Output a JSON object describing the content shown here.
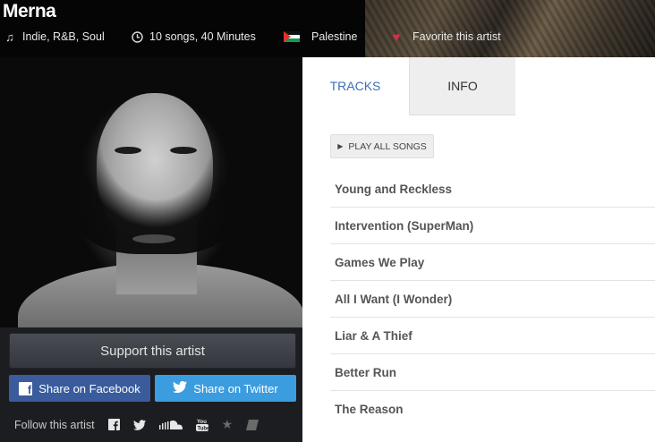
{
  "artist": {
    "name": "Merna",
    "genres": "Indie, R&B, Soul",
    "duration": "10 songs, 40 Minutes",
    "country": "Palestine",
    "favorite_label": "Favorite this artist"
  },
  "icons": {
    "genre": "music-note-icon",
    "duration": "clock-icon",
    "country": "palestine-flag-icon",
    "favorite": "heart-icon"
  },
  "colors": {
    "favorite_heart": "#d6304a",
    "facebook": "#3a5b9c",
    "twitter": "#3b9ce0",
    "tab_active": "#3a6fb5"
  },
  "actions": {
    "support": "Support this artist",
    "share_facebook": "Share on Facebook",
    "share_twitter": "Share on Twitter",
    "follow": "Follow this artist"
  },
  "tabs": [
    {
      "label": "TRACKS",
      "active": true
    },
    {
      "label": "INFO",
      "active": false
    }
  ],
  "play_all": "PLAY ALL SONGS",
  "tracks": [
    "Young and Reckless",
    "Intervention (SuperMan)",
    "Games We Play",
    "All I Want (I Wonder)",
    "Liar & A Thief",
    "Better Run",
    "The Reason"
  ]
}
